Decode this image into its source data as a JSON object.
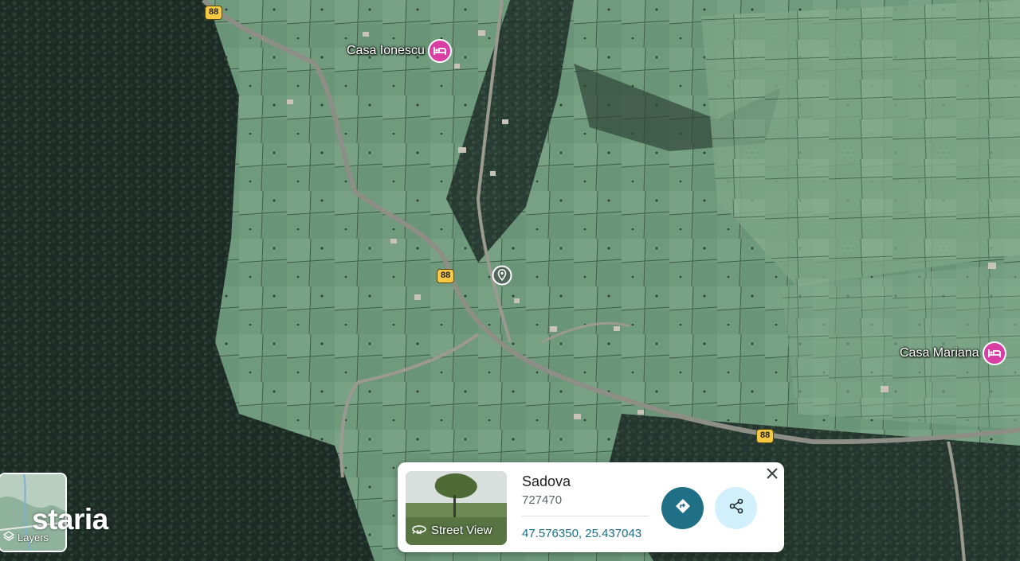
{
  "map": {
    "view": "satellite",
    "route_shields": [
      "88",
      "88",
      "88"
    ],
    "places": [
      {
        "name": "Casa Ionescu",
        "type": "lodging"
      },
      {
        "name": "Casa Mariana",
        "type": "lodging"
      }
    ]
  },
  "layers_button": {
    "label": "Layers"
  },
  "watermark": {
    "text": "staria"
  },
  "place_card": {
    "name": "Sadova",
    "postal_code": "727470",
    "coordinates": "47.576350, 25.437043",
    "street_view_label": "Street View",
    "directions_icon": "directions-icon",
    "share_icon": "share-icon",
    "close_icon": "close-icon"
  },
  "colors": {
    "poi_pin": "#d93ea5",
    "route_shield": "#f6c945",
    "directions_button": "#1f6f86",
    "share_button": "#d2f0fb",
    "coords_text": "#1a6f86"
  }
}
